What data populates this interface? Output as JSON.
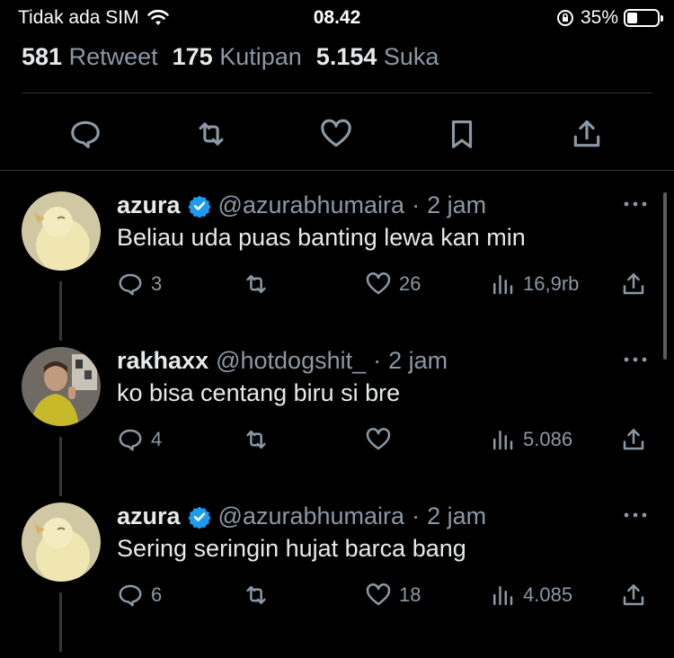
{
  "status_bar": {
    "carrier": "Tidak ada SIM",
    "time": "08.42",
    "battery_percent": "35%",
    "battery_level": 0.35
  },
  "stats": [
    {
      "count": "581",
      "label": "Retweet"
    },
    {
      "count": "175",
      "label": "Kutipan"
    },
    {
      "count": "5.154",
      "label": "Suka"
    }
  ],
  "replies": [
    {
      "name": "azura",
      "verified": true,
      "handle": "@azurabhumaira",
      "separator": "·",
      "time": "2 jam",
      "text": "Beliau uda puas banting lewa kan min",
      "reply_count": "3",
      "retweet_count": "",
      "like_count": "26",
      "view_count": "16,9rb"
    },
    {
      "name": "rakhaxx",
      "verified": false,
      "handle": "@hotdogshit_",
      "separator": "·",
      "time": "2 jam",
      "text": "ko bisa centang biru si bre",
      "reply_count": "4",
      "retweet_count": "",
      "like_count": "",
      "view_count": "5.086"
    },
    {
      "name": "azura",
      "verified": true,
      "handle": "@azurabhumaira",
      "separator": "·",
      "time": "2 jam",
      "text": "Sering seringin hujat barca bang",
      "reply_count": "6",
      "retweet_count": "",
      "like_count": "18",
      "view_count": "4.085"
    }
  ],
  "colors": {
    "background": "#000000",
    "text_primary": "#e7e9ea",
    "text_secondary": "#8b98a5",
    "verified_blue": "#1d9bf0",
    "divider": "#2f3336"
  }
}
